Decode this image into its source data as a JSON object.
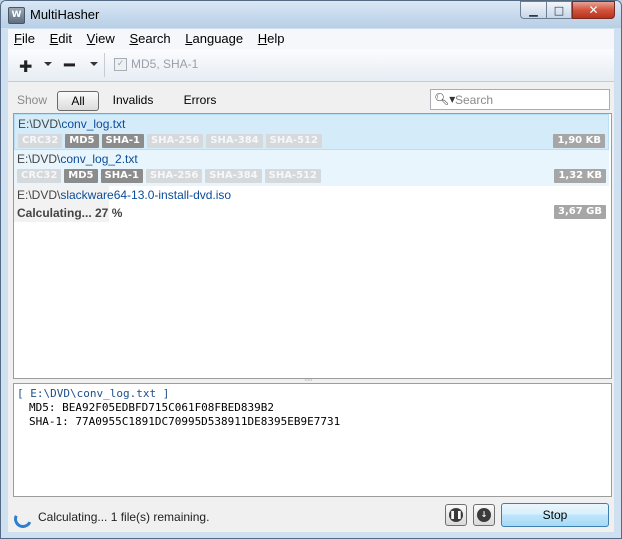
{
  "window": {
    "title": "MultiHasher",
    "icon": "app-icon"
  },
  "menu": [
    {
      "label": "File",
      "accel": "F",
      "rest": "ile"
    },
    {
      "label": "Edit",
      "accel": "E",
      "rest": "dit"
    },
    {
      "label": "View",
      "accel": "V",
      "rest": "iew"
    },
    {
      "label": "Search",
      "accel": "S",
      "rest": "earch"
    },
    {
      "label": "Language",
      "accel": "L",
      "rest": "anguage"
    },
    {
      "label": "Help",
      "accel": "H",
      "rest": "elp"
    }
  ],
  "toolbar": {
    "add_icon": "plus-icon",
    "remove_icon": "minus-icon",
    "algorithms_label": "MD5, SHA-1",
    "algorithms_checked": true
  },
  "filter": {
    "show_label": "Show",
    "all": "All",
    "invalids": "Invalids",
    "errors": "Errors",
    "active": "All"
  },
  "search": {
    "placeholder": "Search",
    "value": ""
  },
  "algorithms": [
    "CRC32",
    "MD5",
    "SHA-1",
    "SHA-256",
    "SHA-384",
    "SHA-512"
  ],
  "files": [
    {
      "dir": "E:\\DVD\\",
      "name": "conv_log.txt",
      "enabled": [
        false,
        true,
        true,
        false,
        false,
        false
      ],
      "size": "1,90 KB",
      "selected": true
    },
    {
      "dir": "E:\\DVD\\",
      "name": "conv_log_2.txt",
      "enabled": [
        false,
        true,
        true,
        false,
        false,
        false
      ],
      "size": "1,32 KB",
      "selected": false
    },
    {
      "dir": "E:\\DVD\\",
      "name": "slackware64-13.0-install-dvd.iso",
      "status": "Calculating... 27 %",
      "progress": 27,
      "size": "3,67 GB",
      "selected": false
    }
  ],
  "output": {
    "header": "[ E:\\DVD\\conv_log.txt ]",
    "lines": [
      "MD5: BEA92F05EDBFD715C061F08FBED839B2",
      "SHA-1: 77A0955C1891DC70995D538911DE8395EB9E7731"
    ]
  },
  "status": {
    "text": "Calculating... 1 file(s) remaining.",
    "pause_icon": "pause-icon",
    "down_icon": "arrow-down-icon",
    "stop_label": "Stop"
  },
  "colors": {
    "selection": "#d4ecfa",
    "path_name": "#0b4c9a",
    "badge_on": "#8c8c8c",
    "badge_off": "#d6d9dc"
  }
}
